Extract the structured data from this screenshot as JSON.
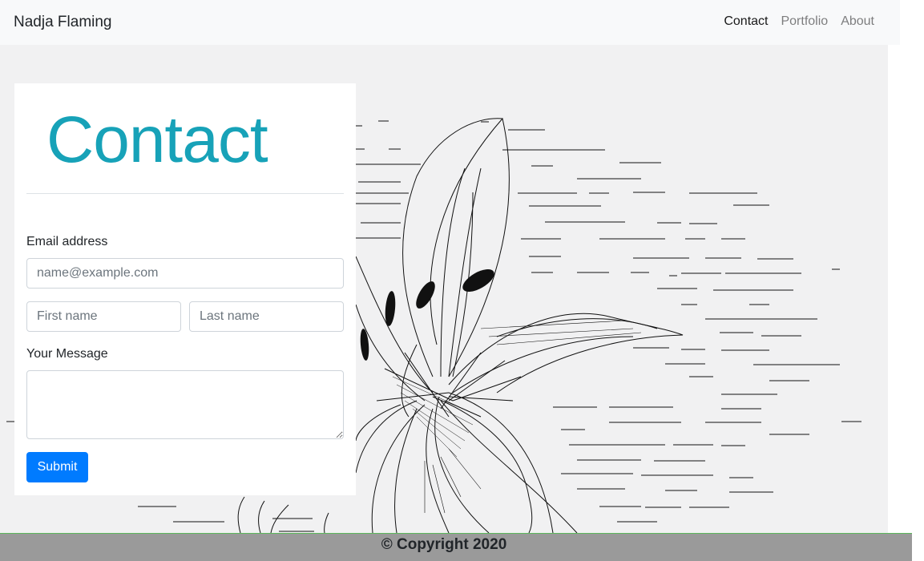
{
  "navbar": {
    "brand": "Nadja Flaming",
    "links": [
      {
        "label": "Contact",
        "active": true
      },
      {
        "label": "Portfolio",
        "active": false
      },
      {
        "label": "About",
        "active": false
      }
    ]
  },
  "form": {
    "title": "Contact",
    "email_label": "Email address",
    "email_placeholder": "name@example.com",
    "first_name_placeholder": "First name",
    "last_name_placeholder": "Last name",
    "message_label": "Your Message",
    "message_value": "",
    "submit_label": "Submit"
  },
  "footer": {
    "text": "© Copyright 2020"
  },
  "colors": {
    "title": "#17a2b8",
    "submit": "#007bff",
    "navbar_bg": "#f8f9fa",
    "footer_bg": "#9a9a9a"
  }
}
